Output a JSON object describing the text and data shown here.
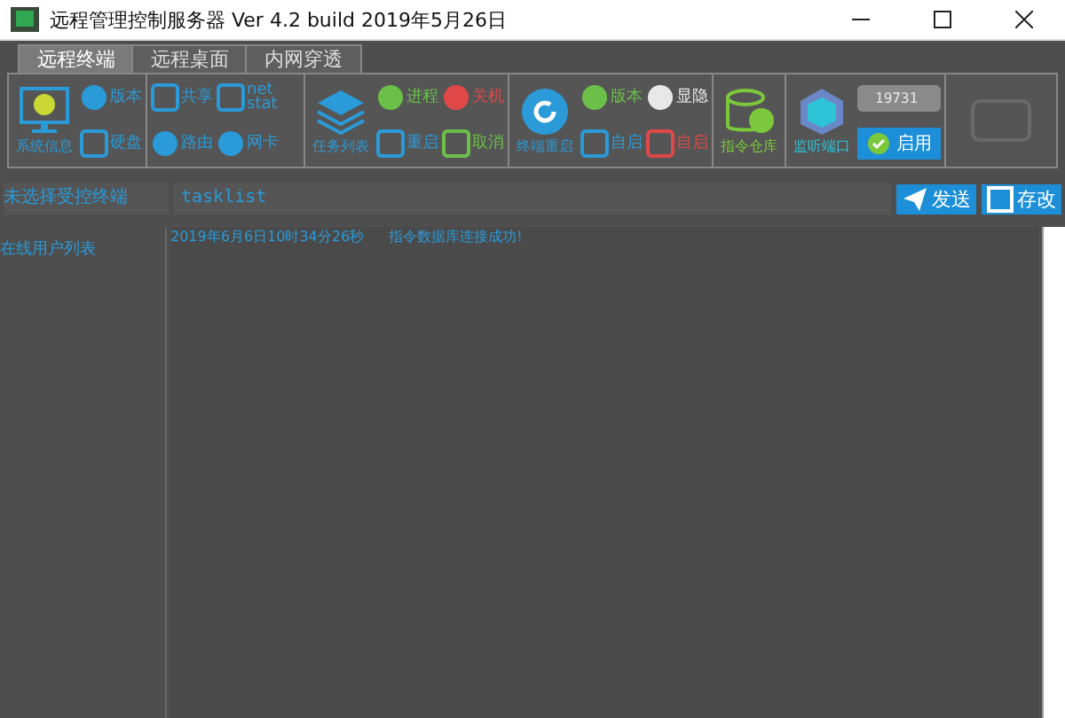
{
  "window": {
    "title": "远程管理控制服务器 Ver 4.2 build 2019年5月26日"
  },
  "tabs": [
    {
      "label": "远程终端",
      "selected": true
    },
    {
      "label": "远程桌面",
      "selected": false
    },
    {
      "label": "内网穿透",
      "selected": false
    }
  ],
  "toolbar": [
    {
      "items": [
        {
          "kind": "big",
          "label": "系统信息",
          "color": "#2a9ad8"
        },
        {
          "kind": "small",
          "label": "版本",
          "color": "#2a9ad8"
        },
        {
          "kind": "small",
          "label": "硬盘",
          "color": "#2a9ad8"
        }
      ]
    },
    {
      "items": [
        {
          "kind": "small",
          "label": "共享",
          "color": "#2a9ad8"
        },
        {
          "kind": "small",
          "label": "路由",
          "color": "#2a9ad8"
        },
        {
          "kind": "small",
          "label": "net stat",
          "color": "#2a9ad8"
        },
        {
          "kind": "small",
          "label": "网卡",
          "color": "#2a9ad8"
        }
      ]
    },
    {
      "items": [
        {
          "kind": "big",
          "label": "任务列表",
          "color": "#2a9ad8"
        },
        {
          "kind": "small",
          "label": "进程",
          "color": "#6cc04a"
        },
        {
          "kind": "small",
          "label": "重启",
          "color": "#2a9ad8"
        },
        {
          "kind": "small",
          "label": "关机",
          "color": "#e04848"
        },
        {
          "kind": "small",
          "label": "取消",
          "color": "#6cc04a"
        }
      ]
    },
    {
      "items": [
        {
          "kind": "big",
          "label": "终端重启",
          "color": "#2a9ad8"
        },
        {
          "kind": "small",
          "label": "版本",
          "color": "#6cc04a"
        },
        {
          "kind": "small",
          "label": "自启",
          "color": "#2a9ad8"
        },
        {
          "kind": "small",
          "label": "显隐",
          "color": "#e8e8e8"
        },
        {
          "kind": "small",
          "label": "自启",
          "color": "#e04848"
        }
      ]
    },
    {
      "items": [
        {
          "kind": "big",
          "label": "指令仓库",
          "color": "#7cc83c"
        }
      ]
    },
    {
      "items": [
        {
          "kind": "big",
          "label": "监听端口",
          "color": "#2ec4d8"
        },
        {
          "kind": "port",
          "label": "19731"
        },
        {
          "kind": "button",
          "label": "启用"
        }
      ]
    }
  ],
  "command_bar": {
    "target_label": "未选择受控终端",
    "command": "tasklist",
    "buttons": [
      "发送",
      "存改"
    ]
  },
  "sidebar": {
    "title": "在线用户列表"
  },
  "log": {
    "lines": [
      {
        "time": "2019年6月6日10时34分26秒",
        "message": "指令数据库连接成功!"
      }
    ]
  }
}
